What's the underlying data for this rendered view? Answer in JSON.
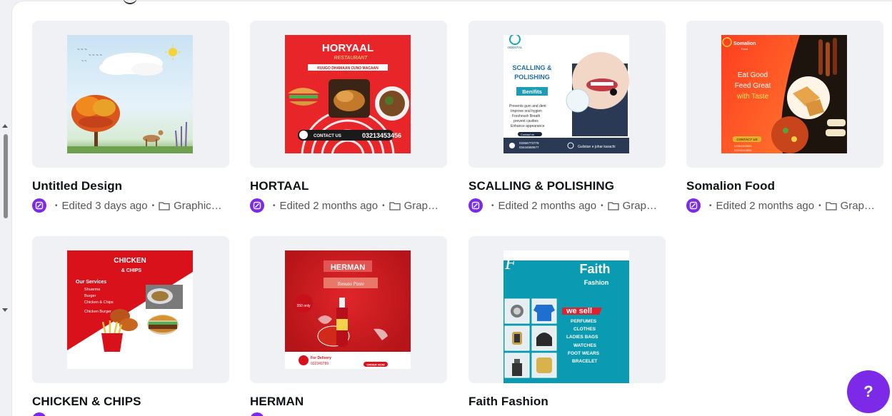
{
  "designs": [
    {
      "title": "Untitled Design",
      "meta": "Edited 3 days ago",
      "folder": "Graphic…"
    },
    {
      "title": "HORTAAL",
      "meta": "Edited 2 months ago",
      "folder": "Grap…"
    },
    {
      "title": "SCALLING & POLISHING",
      "meta": "Edited 2 months ago",
      "folder": "Grap…"
    },
    {
      "title": "Somalion Food",
      "meta": "Edited 2 months ago",
      "folder": "Grap…"
    },
    {
      "title": "CHICKEN & CHIPS"
    },
    {
      "title": "HERMAN"
    },
    {
      "title": "Faith Fashion"
    }
  ],
  "thumbs": {
    "hortaal": {
      "name": "HORYAAL",
      "sub": "RESTAURANT",
      "tag": "KUUGO DHAMAAN CUNO MACAAN",
      "contact": "CONTACT US",
      "phone": "03213453456"
    },
    "scalling": {
      "brand": "ODENTAL",
      "title1": "SCALLING &",
      "title2": "POLISHING",
      "benefits": "Benifits",
      "bullets": [
        "Prevents gum and dent",
        "Improve oral hygien",
        "Freshnssh Breath",
        "prevent cavities",
        "Enhance appearance"
      ],
      "contact": "Contact us",
      "phone1": "03366773778",
      "phone2": "03444560677",
      "address": "Gulistan e johar karachi"
    },
    "somalion": {
      "brand": "Somalion",
      "brand_sub": "Food",
      "line1": "Eat Good",
      "line2": "Feed Great",
      "line3": "with Taste",
      "contact": "CONTACT US",
      "phone1": "03364365666",
      "phone2": "03233444555"
    },
    "chicken": {
      "title": "CHICKEN",
      "sub": "& CHIPS",
      "services": "Our Services",
      "items": [
        "Shuarma",
        "Burger",
        "Chicken & Chips",
        "Chicken Burger"
      ]
    },
    "herman": {
      "name": "HERMAN",
      "sub": "Tomato Paste",
      "price": "350 only",
      "delivery": "For Delivery",
      "phone": "032349789",
      "order": "ORDER NOW"
    },
    "faith": {
      "logo": "F",
      "title": "Faith",
      "sub": "Fashion",
      "sell": "we sell",
      "items": [
        "PERFUMES",
        "CLOTHES",
        "LADIES BAGS",
        "WATCHES",
        "FOOT WEARS",
        "BRACELET"
      ]
    }
  },
  "help": {
    "label": "?"
  },
  "colors": {
    "accent": "#7d2ae8",
    "card_bg": "#f0f1f5"
  }
}
